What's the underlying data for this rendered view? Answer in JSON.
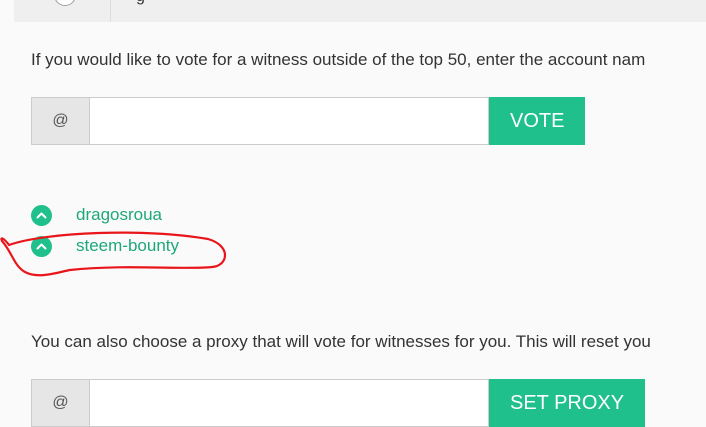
{
  "witness_vote": {
    "description": "If you would like to vote for a witness outside of the top 50, enter the account nam",
    "at_symbol": "@",
    "input_value": "",
    "vote_label": "VOTE"
  },
  "voted_witnesses": [
    {
      "name": "dragosroua"
    },
    {
      "name": "steem-bounty"
    }
  ],
  "proxy": {
    "description": "You can also choose a proxy that will vote for witnesses for you. This will reset you",
    "at_symbol": "@",
    "input_value": "",
    "set_proxy_label": "SET PROXY"
  },
  "colors": {
    "accent": "#1fc08c",
    "link": "#1fa77c",
    "annotation": "#e8161b"
  },
  "icons": {
    "witness_vote": "chevron-up-circle-icon"
  }
}
